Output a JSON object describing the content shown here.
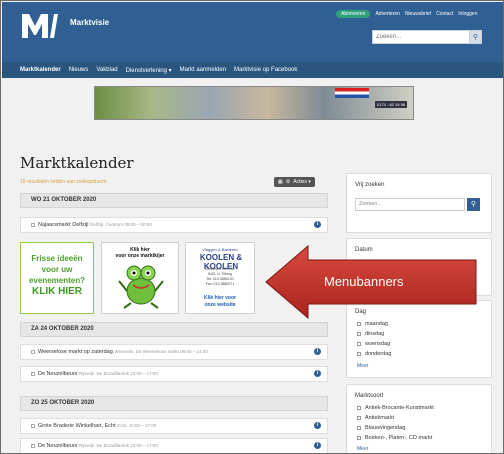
{
  "header": {
    "brand": "Marktvisie",
    "badge": "Abonneren",
    "links": [
      "Adverteren",
      "Nieuwsbrief",
      "Contact",
      "Inloggen"
    ],
    "search_placeholder": "Zoeken...",
    "colors": {
      "header": "#2f5f93",
      "nav": "#2a557f",
      "badge": "#2fa17a"
    }
  },
  "nav": {
    "items": [
      "Marktkalender",
      "Nieuws",
      "Vakblad",
      "Dienstverlening ▾",
      "Markt aanmelden",
      "Marktvisie op Facebook"
    ]
  },
  "banner": {
    "tel": "0174 - 62 19 96"
  },
  "main": {
    "title": "Marktkalender",
    "results": "10 resultaten velden aan zoekopdracht",
    "acties": "Acties ▾"
  },
  "days": [
    {
      "label": "WO 21 OKTOBER 2020",
      "events": [
        {
          "name": "Najaarsmarkt Delfzijl",
          "meta": "Delfzijl, Centrum 09:00 – 00:00"
        }
      ]
    },
    {
      "label": "ZA 24 OKTOBER 2020",
      "events": [
        {
          "name": "Weerselose markt op zaterdag",
          "meta": "Weerselo, De Weerselose markt 08:00 – 14:00"
        },
        {
          "name": "De Neuzelbeurs",
          "meta": "Rijswijk, De Broodfabriek 10:00 – 17:00"
        }
      ]
    },
    {
      "label": "ZO 25 OKTOBER 2020",
      "events": [
        {
          "name": "Grote Braderie Winkelhart, Echt",
          "meta": "Echt, 10:00 – 17:00"
        },
        {
          "name": "De Neuzelbeurs",
          "meta": "Rijswijk, De Broodfabriek 10:00 – 17:00"
        }
      ]
    }
  ],
  "menubanners": {
    "b1": {
      "line1": "Frisse ideeën",
      "line2": "voor uw",
      "line3": "evenementen?",
      "line4": "KLIK HIER"
    },
    "b2": {
      "line1": "Klik hier",
      "line2": "voor onze marktkijer"
    },
    "b3": {
      "top": "Vlaggen & Banieren",
      "name": "KOOLEN & KOOLEN",
      "address": "Sonnevelt 130-132",
      "city": "5421 LL Tilburg",
      "phone": "Tel: 013-3880130",
      "fax": "Fax: 013-3880071",
      "link1": "Klik hier voor",
      "link2": "onze website"
    }
  },
  "callout": {
    "label": "Menubanners",
    "color": "#c7302a"
  },
  "sidebar": {
    "vrij_zoeken": {
      "title": "Vrij zoeken",
      "placeholder": "Zoeken..."
    },
    "datum": {
      "title": "Datum"
    },
    "dag": {
      "title": "Dag",
      "options": [
        "maandag",
        "dinsdag",
        "woensdag",
        "donderdag"
      ],
      "more": "Meer"
    },
    "marktsoort": {
      "title": "Marktsoort",
      "options": [
        "Antiek-Brocante-Kunstmarkt",
        "Antiekmarkt",
        "Blauwvingendag",
        "Boeken-, Platen-, CD markt"
      ],
      "more": "Meer"
    }
  }
}
